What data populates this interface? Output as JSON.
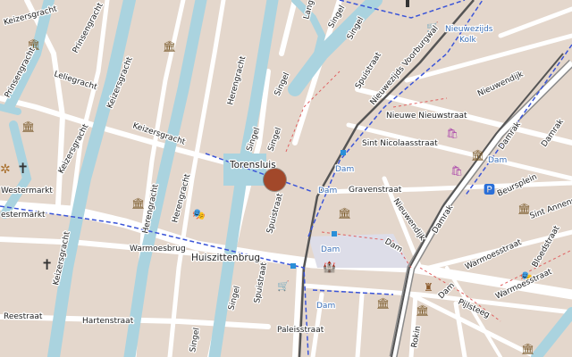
{
  "map": {
    "location_marker": "selected-location-marker",
    "labels": {
      "herengracht_1": "Herengracht",
      "herengracht_2": "Herengracht",
      "herengracht_3": "Herengracht",
      "keizersgracht_1": "Keizersgracht",
      "keizersgracht_2": "Keizersgracht",
      "keizersgracht_3": "Keizersgracht",
      "keizersgracht_4": "Keizersgracht",
      "prinsengracht_1": "Prinsengracht",
      "prinsengracht_2": "Prinsengracht",
      "leliegracht": "Leliegracht",
      "singel_1": "Singel",
      "singel_2": "Singel",
      "singel_3": "Singel",
      "singel_4": "Singel",
      "singel_5": "Singel",
      "singel_6": "Singel",
      "singel_7": "Singel",
      "torensluis": "Torensluis",
      "spuistraat_1": "Spuistraat",
      "spuistraat_2": "Spuistraat",
      "spuistraat_3": "Spuistraat",
      "warmoesbrug": "Warmoesbrug",
      "huiszittenbrug": "Huiszittenbrug",
      "westermarkt_1": "Westermarkt",
      "westermarkt_2": "estermarkt",
      "reestraat": "Reestraat",
      "hartenstraat": "Hartenstraat",
      "paleisstraat": "Paleisstraat",
      "dam_1": "Dam",
      "dam_2": "Dam",
      "dam_3": "Dam",
      "dam_4": "Dam",
      "dam_5": "Dam",
      "dam_6": "Dam",
      "dam_7": "Dam",
      "damrak_1": "Damrak",
      "damrak_2": "Damrak",
      "damrak_3": "Damrak",
      "gravenstraat": "Gravenstraat",
      "nieuwendijk_1": "Nieuwendijk",
      "nieuwendijk_2": "Nieuwendijk",
      "nieuwe_nieuwstraat": "Nieuwe Nieuwstraat",
      "sint_nicolaasstraat": "Sint Nicolaasstraat",
      "nieuwezijds_voorburgwal": "Nieuwezijds Voorburgwal",
      "nieuwezijds_kolk_1": "Nieuwezijds",
      "nieuwezijds_kolk_2": "Kolk",
      "warmoesstraat_1": "Warmoesstraat",
      "warmoesstraat_2": "Warmoesstraat",
      "beursplein": "Beursplein",
      "sint_annens": "Sint Annens",
      "pijlsteeg": "Pijlsteeg",
      "rokin": "Rokin",
      "langestraat": "Langestraat",
      "bloedstraat": "Bloedstraat"
    }
  }
}
